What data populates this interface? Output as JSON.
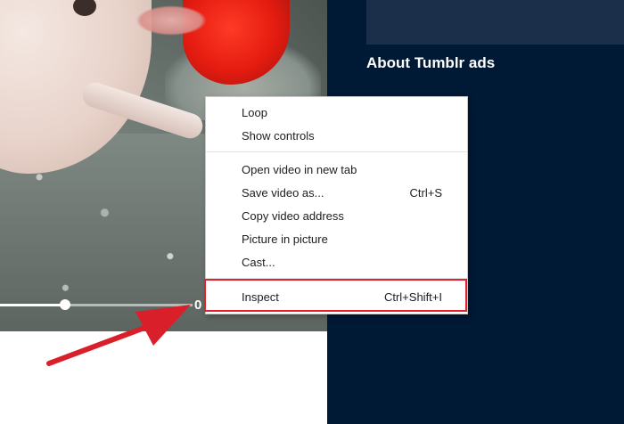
{
  "sidebar": {
    "about_ads": "About Tumblr ads"
  },
  "video": {
    "progress": 0.34,
    "time_text": "0"
  },
  "context_menu": {
    "items": [
      {
        "label": "Loop",
        "shortcut": ""
      },
      {
        "label": "Show controls",
        "shortcut": ""
      },
      {
        "label": "Open video in new tab",
        "shortcut": ""
      },
      {
        "label": "Save video as...",
        "shortcut": "Ctrl+S"
      },
      {
        "label": "Copy video address",
        "shortcut": ""
      },
      {
        "label": "Picture in picture",
        "shortcut": ""
      },
      {
        "label": "Cast...",
        "shortcut": ""
      },
      {
        "label": "Inspect",
        "shortcut": "Ctrl+Shift+I"
      }
    ]
  },
  "colors": {
    "sidebar_bg": "#001935",
    "highlight": "#e2212d",
    "arrow": "#d81f2a"
  },
  "icons": [
    "arrow-annotation-icon"
  ]
}
